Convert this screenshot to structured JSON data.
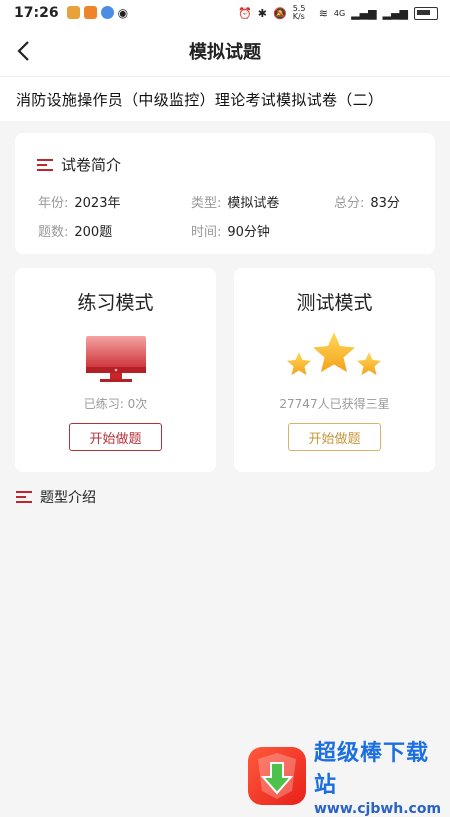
{
  "status": {
    "time": "17:26",
    "net_speed": "5.5 K/s",
    "network": "4G"
  },
  "nav": {
    "title": "模拟试题"
  },
  "exam": {
    "title": "消防设施操作员（中级监控）理论考试模拟试卷（二）"
  },
  "intro": {
    "heading": "试卷简介",
    "year_label": "年份:",
    "year_value": "2023年",
    "type_label": "类型:",
    "type_value": "模拟试卷",
    "score_label": "总分:",
    "score_value": "83分",
    "count_label": "题数:",
    "count_value": "200题",
    "time_label": "时间:",
    "time_value": "90分钟"
  },
  "practice": {
    "title": "练习模式",
    "stat": "已练习: 0次",
    "button": "开始做题",
    "icon": "monitor-icon"
  },
  "test": {
    "title": "测试模式",
    "stat": "27747人已获得三星",
    "button": "开始做题",
    "icon": "three-stars-icon"
  },
  "types": {
    "heading": "题型介绍"
  },
  "watermark": {
    "name": "超级棒下载站",
    "url": "www.cjbwh.com"
  },
  "colors": {
    "accent_red": "#c0262d",
    "gold": "#c8963a",
    "star": "#f7b321"
  }
}
